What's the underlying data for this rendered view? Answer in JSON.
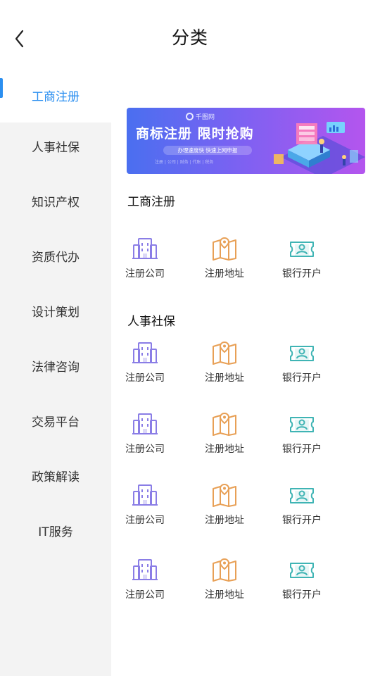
{
  "header": {
    "title": "分类",
    "back_icon": "chevron-left-icon"
  },
  "sidebar": {
    "active_color": "#2b8ff0",
    "items": [
      {
        "label": "工商注册"
      },
      {
        "label": "人事社保"
      },
      {
        "label": "知识产权"
      },
      {
        "label": "资质代办"
      },
      {
        "label": "设计策划"
      },
      {
        "label": "法律咨询"
      },
      {
        "label": "交易平台"
      },
      {
        "label": "政策解读"
      },
      {
        "label": "IT服务"
      }
    ]
  },
  "banner": {
    "logo": "千图网",
    "title": "商标注册  限时抢购",
    "subtitle": "办理速度快  快速上网申报",
    "tags": "注册 | 公司 | 财务 | 代账 | 税务"
  },
  "sections": [
    {
      "title": "工商注册"
    },
    {
      "title": "人事社保"
    }
  ],
  "services": {
    "company": {
      "label": "注册公司",
      "icon": "building-icon",
      "color": "#8a7de6"
    },
    "address": {
      "label": "注册地址",
      "icon": "map-pin-icon",
      "color": "#e8a056"
    },
    "bank": {
      "label": "银行开户",
      "icon": "bank-card-icon",
      "color": "#3fb4b4"
    }
  }
}
